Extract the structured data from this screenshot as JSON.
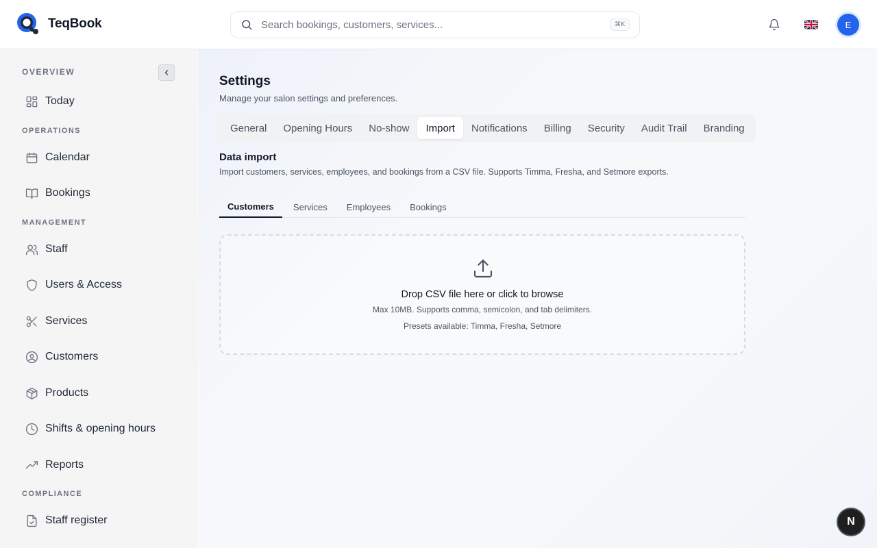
{
  "app": {
    "name": "TeqBook"
  },
  "header": {
    "search_placeholder": "Search bookings, customers, services...",
    "search_shortcut": "⌘K",
    "avatar_initial": "E"
  },
  "sidebar": {
    "sections": {
      "overview": "OVERVIEW",
      "operations": "OPERATIONS",
      "management": "MANAGEMENT",
      "compliance": "COMPLIANCE"
    },
    "items": [
      {
        "label": "Today",
        "icon": "dashboard-icon"
      },
      {
        "label": "Calendar",
        "icon": "calendar-icon"
      },
      {
        "label": "Bookings",
        "icon": "book-icon"
      },
      {
        "label": "Staff",
        "icon": "users-icon"
      },
      {
        "label": "Users & Access",
        "icon": "shield-icon"
      },
      {
        "label": "Services",
        "icon": "scissors-icon"
      },
      {
        "label": "Customers",
        "icon": "user-circle-icon"
      },
      {
        "label": "Products",
        "icon": "package-icon"
      },
      {
        "label": "Shifts & opening hours",
        "icon": "clock-icon"
      },
      {
        "label": "Reports",
        "icon": "trending-up-icon"
      },
      {
        "label": "Staff register",
        "icon": "file-check-icon"
      }
    ]
  },
  "page": {
    "title": "Settings",
    "subtitle": "Manage your salon settings and preferences.",
    "tabs": [
      "General",
      "Opening Hours",
      "No-show",
      "Import",
      "Notifications",
      "Billing",
      "Security",
      "Audit Trail",
      "Branding"
    ],
    "active_tab": "Import"
  },
  "import": {
    "title": "Data import",
    "description": "Import customers, services, employees, and bookings from a CSV file. Supports Timma, Fresha, and Setmore exports.",
    "subtabs": [
      "Customers",
      "Services",
      "Employees",
      "Bookings"
    ],
    "active_subtab": "Customers",
    "dropzone": {
      "title": "Drop CSV file here or click to browse",
      "limits": "Max 10MB. Supports comma, semicolon, and tab delimiters.",
      "presets": "Presets available: Timma, Fresha, Setmore"
    }
  },
  "fab_label": "N",
  "colors": {
    "accent": "#2563eb",
    "sidebar_bg": "#f5f5f5",
    "text": "#111827"
  }
}
